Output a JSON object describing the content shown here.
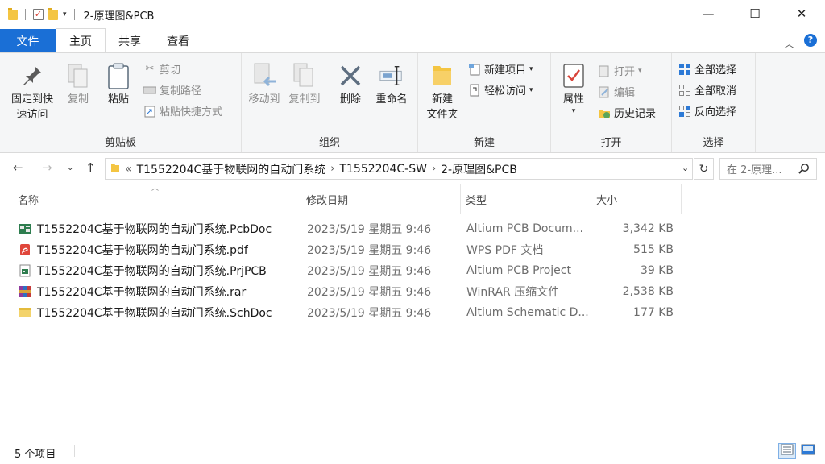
{
  "window": {
    "title": "2-原理图&PCB",
    "controls": {
      "minimize": "—",
      "maximize": "☐",
      "close": "✕"
    }
  },
  "tabs": [
    {
      "label": "文件"
    },
    {
      "label": "主页"
    },
    {
      "label": "共享"
    },
    {
      "label": "查看"
    }
  ],
  "ribbon": {
    "clipboard": {
      "pin_label_1": "固定到快",
      "pin_label_2": "速访问",
      "copy_label": "复制",
      "paste_label": "粘贴",
      "cut_label": "剪切",
      "copy_path_label": "复制路径",
      "paste_shortcut_label": "粘贴快捷方式",
      "group_label": "剪贴板"
    },
    "organize": {
      "move_label": "移动到",
      "copyto_label": "复制到",
      "delete_label": "删除",
      "rename_label": "重命名",
      "group_label": "组织"
    },
    "new": {
      "newfolder_label_1": "新建",
      "newfolder_label_2": "文件夹",
      "newitem_label": "新建项目",
      "easyaccess_label": "轻松访问",
      "group_label": "新建"
    },
    "open": {
      "properties_label": "属性",
      "open_label": "打开",
      "edit_label": "编辑",
      "history_label": "历史记录",
      "group_label": "打开"
    },
    "select": {
      "selectall_label": "全部选择",
      "selectnone_label": "全部取消",
      "invert_label": "反向选择",
      "group_label": "选择"
    }
  },
  "address": {
    "overflow": "«",
    "crumbs": [
      "T1552204C基于物联网的自动门系统",
      "T1552204C-SW",
      "2-原理图&PCB"
    ],
    "search_placeholder": "在 2-原理..."
  },
  "columns": {
    "name": "名称",
    "date": "修改日期",
    "type": "类型",
    "size": "大小"
  },
  "files": [
    {
      "name": "T1552204C基于物联网的自动门系统.PcbDoc",
      "date": "2023/5/19 星期五 9:46",
      "type": "Altium PCB Docum...",
      "size": "3,342 KB",
      "icon": "pcbdoc-icon"
    },
    {
      "name": "T1552204C基于物联网的自动门系统.pdf",
      "date": "2023/5/19 星期五 9:46",
      "type": "WPS PDF 文档",
      "size": "515 KB",
      "icon": "pdf-icon"
    },
    {
      "name": "T1552204C基于物联网的自动门系统.PrjPCB",
      "date": "2023/5/19 星期五 9:46",
      "type": "Altium PCB Project",
      "size": "39 KB",
      "icon": "prjpcb-icon"
    },
    {
      "name": "T1552204C基于物联网的自动门系统.rar",
      "date": "2023/5/19 星期五 9:46",
      "type": "WinRAR 压缩文件",
      "size": "2,538 KB",
      "icon": "rar-icon"
    },
    {
      "name": "T1552204C基于物联网的自动门系统.SchDoc",
      "date": "2023/5/19 星期五 9:46",
      "type": "Altium Schematic D...",
      "size": "177 KB",
      "icon": "schdoc-icon"
    }
  ],
  "status": {
    "count": "5 个项目"
  },
  "colors": {
    "accent": "#1a6fd6",
    "ribbon_bg": "#f5f6f7"
  }
}
